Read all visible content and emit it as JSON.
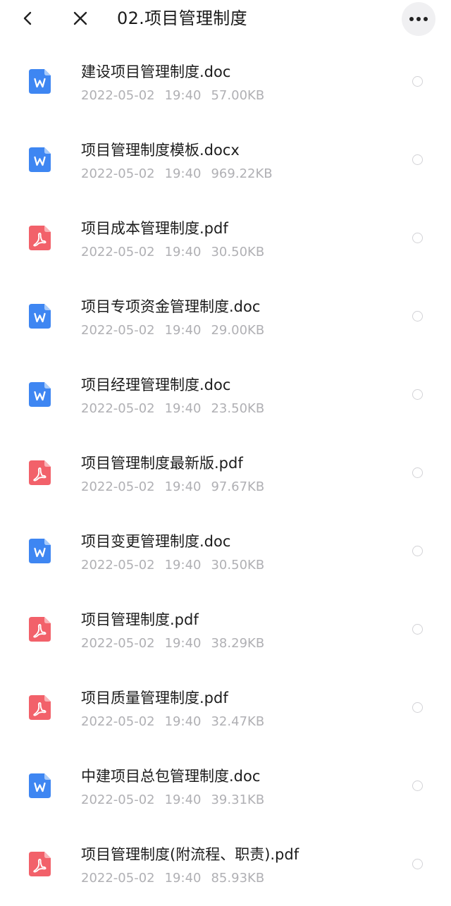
{
  "header": {
    "title": "02.项目管理制度",
    "back_icon": "chevron-left-icon",
    "close_icon": "close-icon",
    "more_icon": "more-dots-icon"
  },
  "colors": {
    "word": "#3e86f2",
    "pdf": "#f2616a",
    "meta": "#b0b0b4"
  },
  "files": [
    {
      "name": "建设项目管理制度.doc",
      "date": "2022-05-02",
      "time": "19:40",
      "size": "57.00KB",
      "type": "word"
    },
    {
      "name": "项目管理制度模板.docx",
      "date": "2022-05-02",
      "time": "19:40",
      "size": "969.22KB",
      "type": "word"
    },
    {
      "name": "项目成本管理制度.pdf",
      "date": "2022-05-02",
      "time": "19:40",
      "size": "30.50KB",
      "type": "pdf"
    },
    {
      "name": "项目专项资金管理制度.doc",
      "date": "2022-05-02",
      "time": "19:40",
      "size": "29.00KB",
      "type": "word"
    },
    {
      "name": "项目经理管理制度.doc",
      "date": "2022-05-02",
      "time": "19:40",
      "size": "23.50KB",
      "type": "word"
    },
    {
      "name": "项目管理制度最新版.pdf",
      "date": "2022-05-02",
      "time": "19:40",
      "size": "97.67KB",
      "type": "pdf"
    },
    {
      "name": "项目变更管理制度.doc",
      "date": "2022-05-02",
      "time": "19:40",
      "size": "30.50KB",
      "type": "word"
    },
    {
      "name": "项目管理制度.pdf",
      "date": "2022-05-02",
      "time": "19:40",
      "size": "38.29KB",
      "type": "pdf"
    },
    {
      "name": "项目质量管理制度.pdf",
      "date": "2022-05-02",
      "time": "19:40",
      "size": "32.47KB",
      "type": "pdf"
    },
    {
      "name": "中建项目总包管理制度.doc",
      "date": "2022-05-02",
      "time": "19:40",
      "size": "39.31KB",
      "type": "word"
    },
    {
      "name": "项目管理制度(附流程、职责).pdf",
      "date": "2022-05-02",
      "time": "19:40",
      "size": "85.93KB",
      "type": "pdf"
    }
  ]
}
